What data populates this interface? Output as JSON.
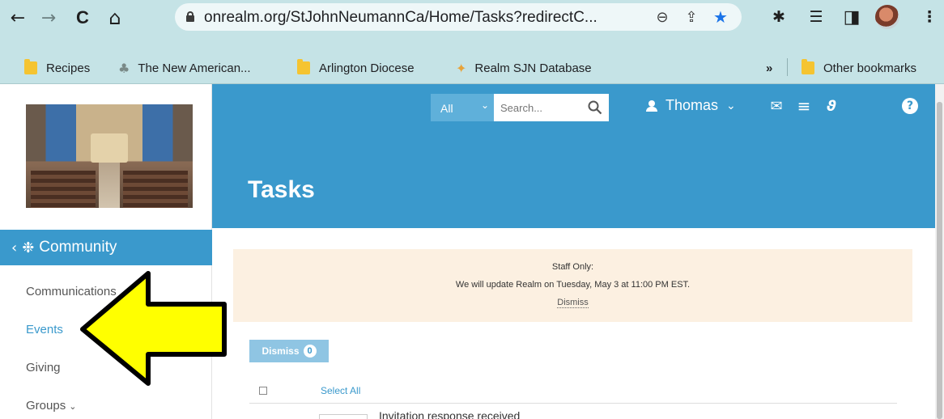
{
  "browser": {
    "url": "onrealm.org/StJohnNeumannCa/Home/Tasks?redirectC...",
    "nav": {
      "back": "←",
      "forward": "→",
      "reload": "C",
      "home": "⌂"
    },
    "omnibox_icons": {
      "zoom": "⊖",
      "share": "⇪",
      "bookmark_star": "★"
    },
    "toolbar_icons": {
      "extensions": "✱",
      "reading_list": "☰",
      "side_panel": "◨",
      "menu": "⋮"
    },
    "bookmarks": [
      {
        "label": "Recipes",
        "icon": "folder-icon"
      },
      {
        "label": "The New American...",
        "icon": "tree-icon"
      },
      {
        "label": "Arlington Diocese",
        "icon": "folder-icon"
      },
      {
        "label": "Realm SJN Database",
        "icon": "realm-icon"
      }
    ],
    "bookmarks_overflow": "»",
    "other_bookmarks": "Other bookmarks",
    "colors": {
      "chrome": "#c5e3e6",
      "star": "#1a73e8"
    }
  },
  "sidebar": {
    "section": "Community",
    "back_chevron": "‹",
    "section_icon": "❉",
    "items": [
      {
        "label": "Communications",
        "active": false
      },
      {
        "label": "Events",
        "active": true
      },
      {
        "label": "Giving",
        "active": false
      },
      {
        "label": "Groups",
        "active": false,
        "caret": "⌄"
      }
    ]
  },
  "header": {
    "scope": "All",
    "scope_caret": "⌄",
    "search_placeholder": "Search...",
    "user_name": "Thomas",
    "user_caret": "⌄",
    "icons": {
      "mail": "✉",
      "list": "≡",
      "realm": "ϑ",
      "help": "?"
    },
    "colors": {
      "brand": "#3a99cc"
    }
  },
  "page": {
    "title": "Tasks",
    "notice": {
      "line1": "Staff Only:",
      "line2": "We will update Realm on Tuesday, May 3 at 11:00 PM EST.",
      "dismiss": "Dismiss"
    },
    "dismiss_button": {
      "label": "Dismiss",
      "count": "0"
    },
    "select_all": "Select All",
    "first_row_text": "Invitation response received"
  },
  "annotation": {
    "arrow_color": "#ffff00",
    "points_to": "Events"
  }
}
